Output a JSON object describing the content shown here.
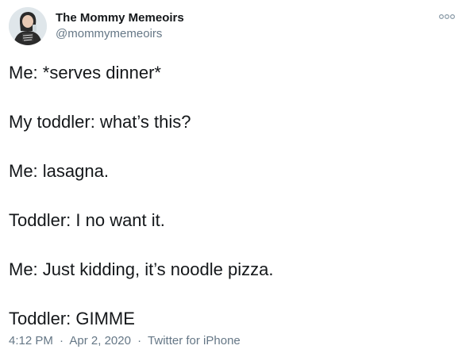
{
  "author": {
    "display_name": "The Mommy Memeoirs",
    "handle": "@mommymemeoirs",
    "avatar_icon": "profile-avatar"
  },
  "more_icon": "more-options-icon",
  "tweet": {
    "lines": [
      "Me: *serves dinner*",
      "My toddler: what’s this?",
      "Me: lasagna.",
      "Toddler: I no want it.",
      "Me: Just kidding, it’s noodle pizza.",
      "Toddler: GIMME"
    ]
  },
  "meta": {
    "time": "4:12 PM",
    "separator": "·",
    "date": "Apr 2, 2020",
    "source": "Twitter for iPhone"
  },
  "colors": {
    "text": "#14171a",
    "secondary": "#657786",
    "background": "#ffffff"
  }
}
